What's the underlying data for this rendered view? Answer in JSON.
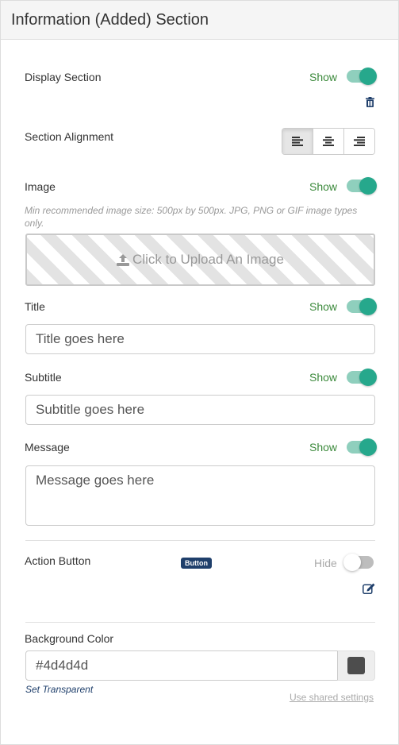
{
  "header": {
    "title": "Information (Added) Section"
  },
  "display_section": {
    "label": "Display Section",
    "state_label": "Show",
    "enabled": true,
    "delete_icon": "trash-icon"
  },
  "section_alignment": {
    "label": "Section Alignment",
    "options": [
      {
        "name": "align-left-icon",
        "active": true
      },
      {
        "name": "align-center-icon",
        "active": false
      },
      {
        "name": "align-right-icon",
        "active": false
      }
    ]
  },
  "image": {
    "label": "Image",
    "state_label": "Show",
    "enabled": true,
    "hint": "Min recommended image size: 500px by 500px. JPG, PNG or GIF image types only.",
    "upload_label": "Click to Upload An Image",
    "upload_icon": "upload-icon"
  },
  "title": {
    "label": "Title",
    "state_label": "Show",
    "enabled": true,
    "placeholder": "Title goes here",
    "value": ""
  },
  "subtitle": {
    "label": "Subtitle",
    "state_label": "Show",
    "enabled": true,
    "placeholder": "Subtitle goes here",
    "value": ""
  },
  "message": {
    "label": "Message",
    "state_label": "Show",
    "enabled": true,
    "placeholder": "Message goes here",
    "value": ""
  },
  "action_button": {
    "label": "Action Button",
    "badge": "Button",
    "state_label": "Hide",
    "enabled": false,
    "edit_icon": "edit-icon"
  },
  "background_color": {
    "label": "Background Color",
    "value": "#4d4d4d",
    "swatch_color": "#4d4d4d",
    "set_transparent_label": "Set Transparent",
    "shared_settings_label": "Use shared settings"
  },
  "colors": {
    "accent": "#26a88c",
    "show_text": "#3c8a3c",
    "badge_bg": "#1f3f6b"
  }
}
